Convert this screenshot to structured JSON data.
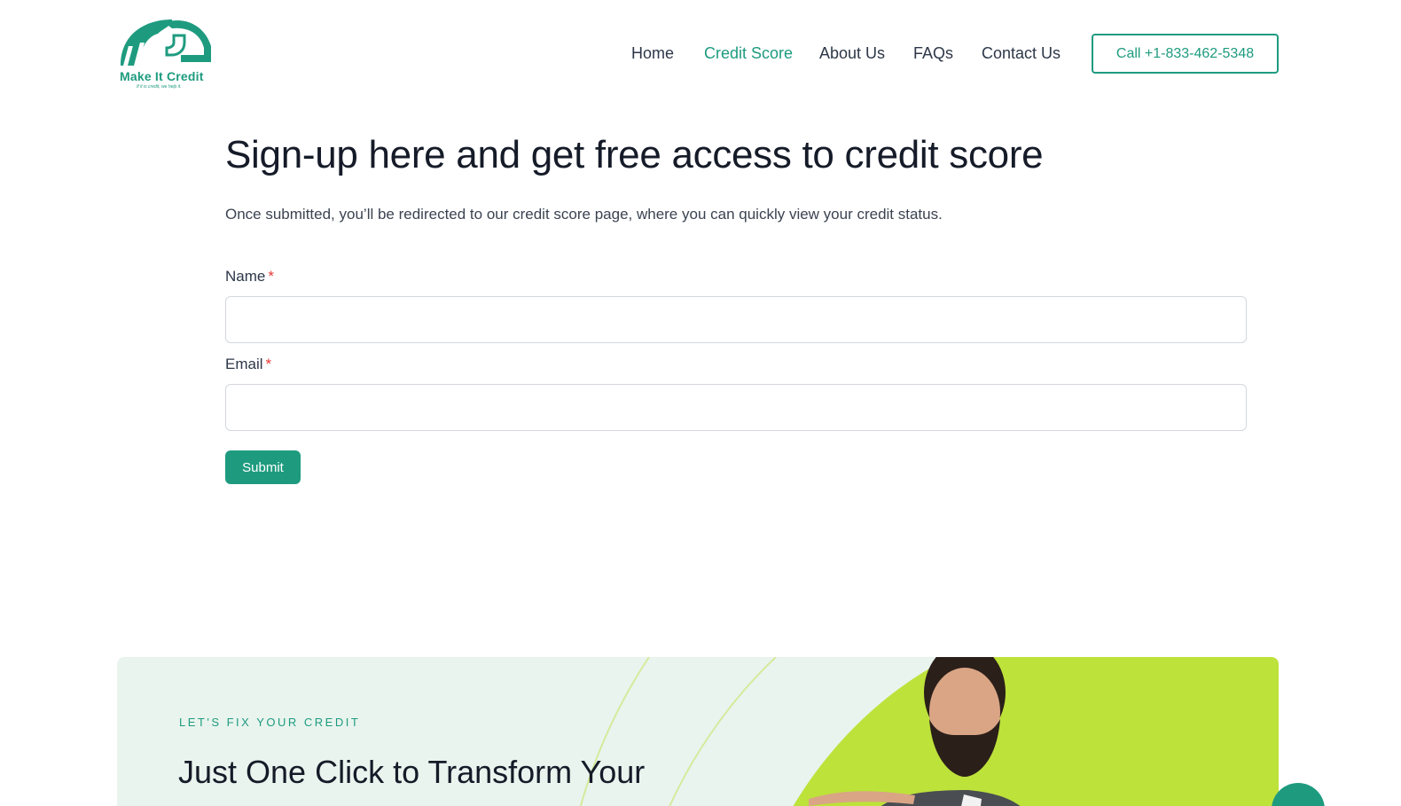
{
  "brand": {
    "name": "Make It Credit",
    "tagline": "If it is credit, we help it."
  },
  "nav": {
    "items": [
      {
        "label": "Home",
        "active": false
      },
      {
        "label": "Credit Score",
        "active": true
      },
      {
        "label": "About Us",
        "active": false
      },
      {
        "label": "FAQs",
        "active": false
      },
      {
        "label": "Contact Us",
        "active": false
      }
    ],
    "call_label": "Call +1-833-462-5348"
  },
  "form": {
    "title": "Sign-up here and get free access to credit score",
    "subtitle": "Once submitted, you’ll be redirected to our credit score page, where you can quickly view your credit status.",
    "fields": [
      {
        "label": "Name",
        "required_mark": "*",
        "value": "",
        "placeholder": ""
      },
      {
        "label": "Email",
        "required_mark": "*",
        "value": "",
        "placeholder": ""
      }
    ],
    "submit_label": "Submit"
  },
  "promo": {
    "kicker": "LET'S FIX YOUR CREDIT",
    "title": "Just One Click to Transform Your"
  },
  "colors": {
    "accent": "#1e9b7f",
    "lime": "#bde23a",
    "promo_bg": "#e9f4ee"
  },
  "icons": {
    "logo": "house-roof-logo-icon",
    "chat": "chat-icon"
  }
}
